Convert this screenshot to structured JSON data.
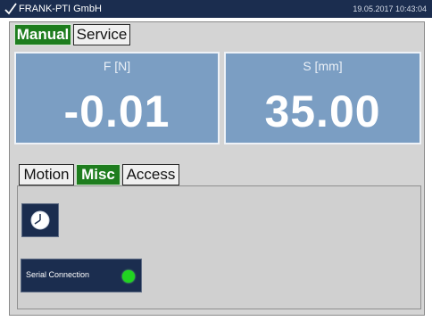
{
  "app": {
    "title": "FRANK-PTI GmbH",
    "datetime": "19.05.2017 10:43:04"
  },
  "mode_tabs": [
    {
      "label": "Manual",
      "active": true
    },
    {
      "label": "Service",
      "active": false
    }
  ],
  "readouts": [
    {
      "label": "F [N]",
      "value": "-0.01"
    },
    {
      "label": "S [mm]",
      "value": "35.00"
    }
  ],
  "section_tabs": [
    {
      "label": "Motion",
      "active": false
    },
    {
      "label": "Misc",
      "active": true
    },
    {
      "label": "Access",
      "active": false
    }
  ],
  "misc": {
    "clock_icon": "clock-icon",
    "serial_connection": {
      "label": "Serial Connection",
      "status": "connected",
      "status_color": "#21d421"
    }
  },
  "colors": {
    "titlebar": "#1b2d4f",
    "active_tab": "#1e7d1e",
    "readout_bg": "#7b9ec3"
  }
}
